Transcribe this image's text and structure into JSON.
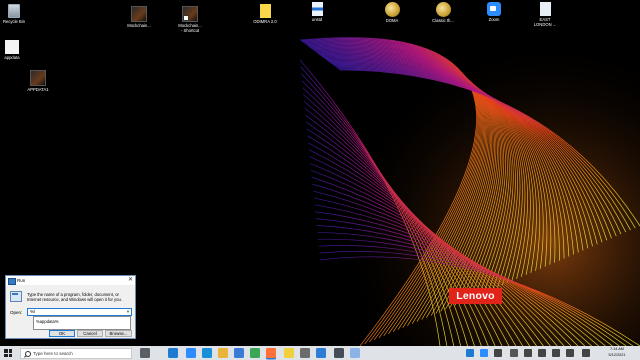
{
  "desktop": {
    "icons": [
      {
        "id": "recycle-bin",
        "label": "Recycle Bin",
        "glyph": "bin"
      },
      {
        "id": "appdata",
        "label": "appdata",
        "glyph": "file"
      },
      {
        "id": "appdata1",
        "label": "APPDATA1",
        "glyph": "thumb"
      },
      {
        "id": "mockchain",
        "label": "Mockchain...",
        "glyph": "thumb"
      },
      {
        "id": "mockchain-shortcut",
        "label": "Mockchain...\n- Shortcut",
        "glyph": "thumb"
      },
      {
        "id": "odimra",
        "label": "ODIMRA 2.0",
        "glyph": "yellow"
      },
      {
        "id": "unstd",
        "label": "unstd",
        "glyph": "docb"
      },
      {
        "id": "doma",
        "label": "DOMA",
        "glyph": "disk"
      },
      {
        "id": "classic",
        "label": "Classic th...",
        "glyph": "disk"
      },
      {
        "id": "zoom",
        "label": "Zoom",
        "glyph": "zoom"
      },
      {
        "id": "east-london",
        "label": "EAST\nLONDON ...",
        "glyph": "doc"
      }
    ],
    "brand": "Lenovo"
  },
  "run_dialog": {
    "title": "Run",
    "close_glyph": "✕",
    "description": "Type the name of a program, folder, document, or Internet resource, and Windows will open it for you.",
    "open_label": "Open:",
    "open_value": "%l",
    "suggestion": "%appdata%",
    "ok": "OK",
    "cancel": "Cancel",
    "browse": "Browse..."
  },
  "taskbar": {
    "search_placeholder": "Type here to search",
    "pinned": [
      {
        "name": "task-view-icon",
        "color": "#5a5f66"
      },
      {
        "name": "l-app-icon",
        "color": "#1f7ad1"
      },
      {
        "name": "zoom-taskbar-icon",
        "color": "#2d8cff"
      },
      {
        "name": "edge-icon",
        "color": "#1b8fd8"
      },
      {
        "name": "explorer-icon",
        "color": "#e8b43a"
      },
      {
        "name": "store-icon",
        "color": "#3a7bd5"
      },
      {
        "name": "chrome-icon",
        "color": "#3aa757"
      },
      {
        "name": "firefox-icon",
        "color": "#ff7139"
      },
      {
        "name": "sticky-notes-icon",
        "color": "#f2d03b"
      },
      {
        "name": "settings-icon",
        "color": "#6b6b6b"
      },
      {
        "name": "mail-icon",
        "color": "#2e7cd6"
      },
      {
        "name": "calculator-icon",
        "color": "#444c56"
      },
      {
        "name": "notepad-icon",
        "color": "#8ab4e8"
      }
    ],
    "tray": [
      {
        "name": "tray-l-icon",
        "color": "#1f7ad1"
      },
      {
        "name": "tray-zoom-icon",
        "color": "#2d8cff"
      },
      {
        "name": "tray-people-icon",
        "color": "#444"
      },
      {
        "name": "tray-up-arrow-icon",
        "color": "#555"
      },
      {
        "name": "tray-network-icon",
        "color": "#444"
      },
      {
        "name": "tray-volume-icon",
        "color": "#444"
      },
      {
        "name": "tray-lang-icon",
        "color": "#444"
      },
      {
        "name": "tray-battery-icon",
        "color": "#444"
      },
      {
        "name": "tray-keyboard-icon",
        "color": "#444"
      }
    ],
    "time": "7:14 AM",
    "date": "5/12/2021"
  }
}
